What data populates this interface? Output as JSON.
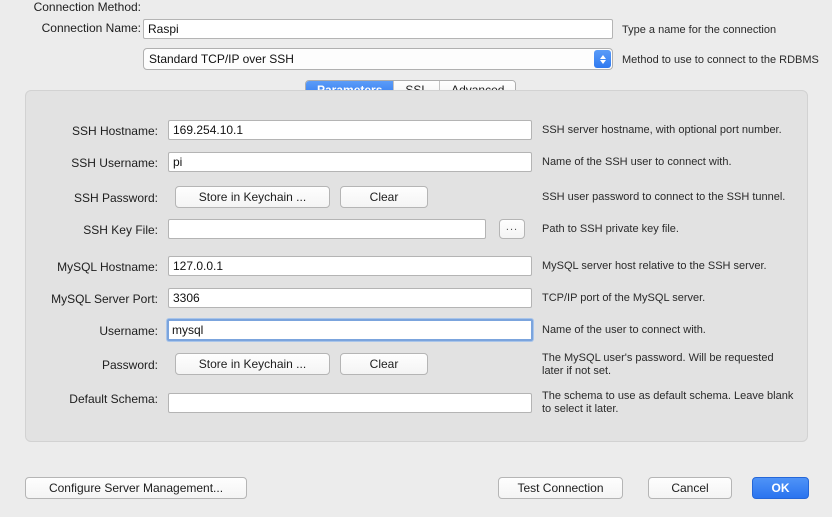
{
  "header": {
    "connection_name": {
      "label": "Connection Name:",
      "value": "Raspi",
      "placeholder": "",
      "hint": "Type a name for the connection"
    },
    "connection_method": {
      "label": "Connection Method:",
      "value": "Standard TCP/IP over SSH",
      "hint": "Method to use to connect to the RDBMS",
      "options": [
        "Standard TCP/IP over SSH"
      ]
    }
  },
  "tabs": [
    {
      "label": "Parameters",
      "active": true
    },
    {
      "label": "SSL",
      "active": false
    },
    {
      "label": "Advanced",
      "active": false
    }
  ],
  "parameters": {
    "rows": [
      {
        "label": "SSH Hostname:",
        "value": "169.254.10.1",
        "hint": "SSH server hostname, with  optional port number."
      },
      {
        "label": "SSH Username:",
        "value": "pi",
        "hint": "Name of the SSH user to connect with."
      },
      {
        "label": "SSH Password:",
        "value": "",
        "hint": "SSH user password to connect to the SSH tunnel."
      },
      {
        "label": "SSH Key File:",
        "value": "",
        "hint": "Path to SSH private key file."
      },
      {
        "label": "MySQL Hostname:",
        "value": "127.0.0.1",
        "hint": "MySQL server host relative to the SSH server."
      },
      {
        "label": "MySQL Server Port:",
        "value": "3306",
        "hint": "TCP/IP port of the MySQL server."
      },
      {
        "label": "Username:",
        "value": "mysql",
        "hint": "Name of the user to connect with."
      },
      {
        "label": "Password:",
        "value": "",
        "hint": "The MySQL user's password. Will be requested\nlater if not set."
      },
      {
        "label": "Default Schema:",
        "value": "",
        "hint": "The schema to use as default schema. Leave blank\nto select it later."
      }
    ],
    "keychain_button": "Store in Keychain ...",
    "clear_button": "Clear",
    "browse_button": "..."
  },
  "footer": {
    "configure": "Configure Server Management...",
    "test": "Test Connection",
    "cancel": "Cancel",
    "ok": "OK"
  },
  "colors": {
    "accent": "#2f78ef",
    "window_bg": "#ececec",
    "panel_bg": "#e2e2e2",
    "focus_ring": "#7ba4dd"
  }
}
